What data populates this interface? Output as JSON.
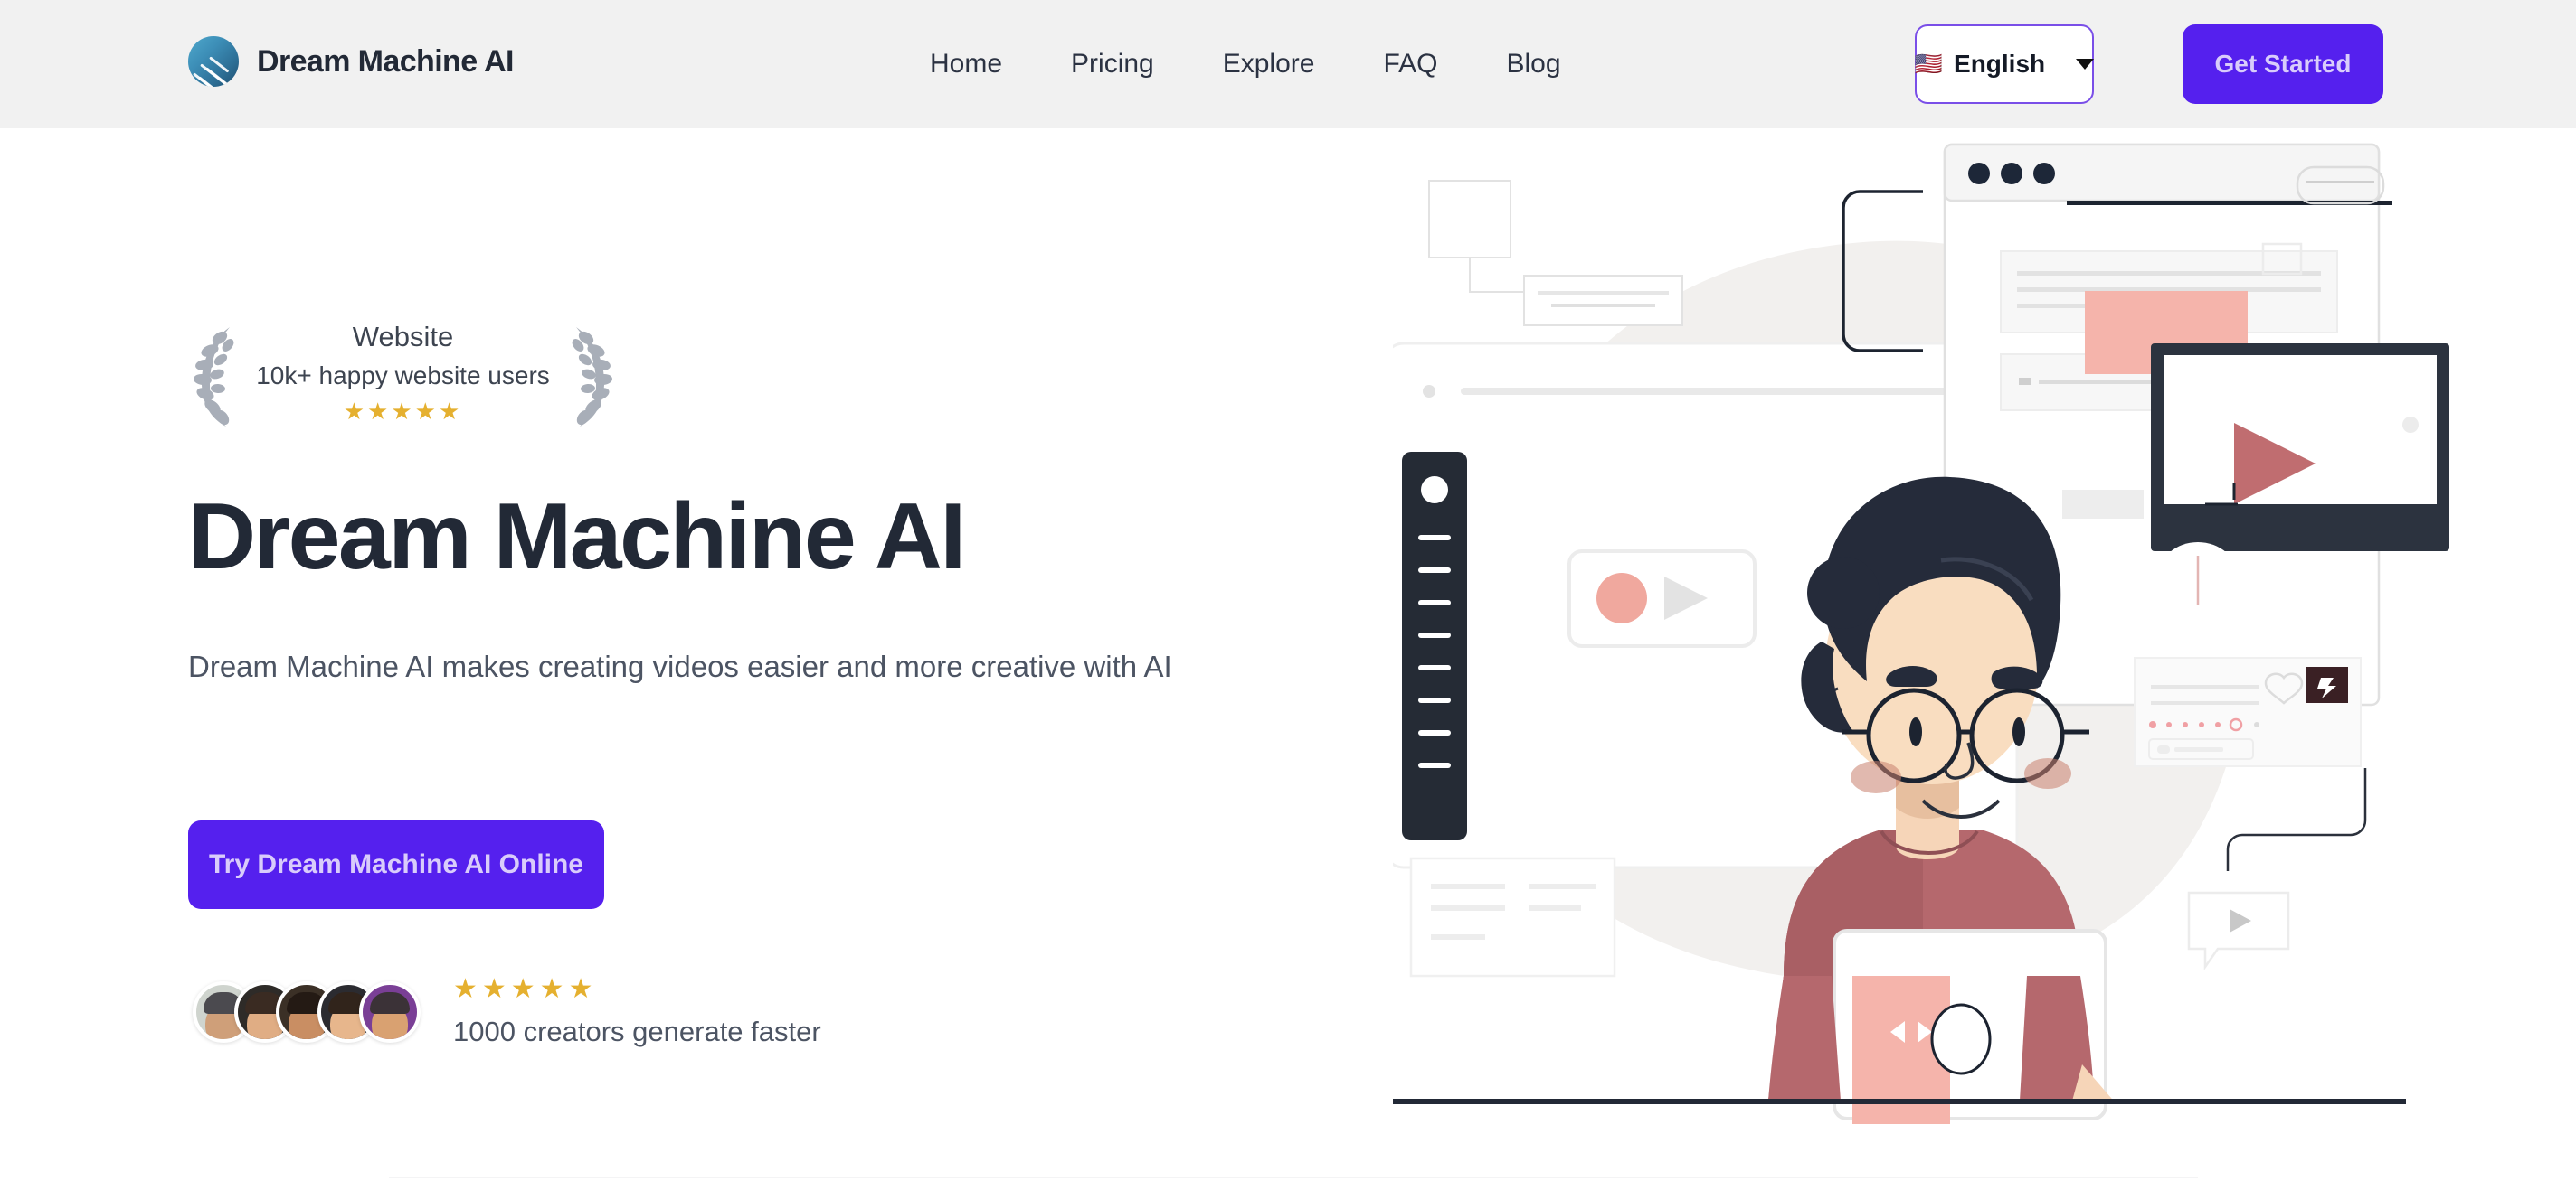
{
  "header": {
    "brand": {
      "name": "Dream Machine AI",
      "logo_icon": "dream-machine-logo-icon"
    },
    "nav": [
      {
        "label": "Home"
      },
      {
        "label": "Pricing"
      },
      {
        "label": "Explore"
      },
      {
        "label": "FAQ"
      },
      {
        "label": "Blog"
      }
    ],
    "language": {
      "flag": "🇺🇸",
      "label": "English",
      "chevron_icon": "chevron-down-icon"
    },
    "get_started_label": "Get Started",
    "background_color": "#f1f1f1"
  },
  "hero": {
    "badge": {
      "title": "Website",
      "subtitle": "10k+ happy website users",
      "stars": "★★★★★",
      "laurel_icon": "laurel-wreath-icon",
      "star_color": "#e5b02f",
      "laurel_color": "#a8aeb8"
    },
    "headline": "Dream Machine AI",
    "subheadline": "Dream Machine AI makes creating videos easier and more creative with AI",
    "cta_label": "Try Dream Machine AI Online",
    "social_proof": {
      "stars": "★★★★★",
      "text": "1000 creators generate faster",
      "avatar_count": 5
    },
    "illustration": {
      "name": "video-creator-illustration",
      "alt": "Person with glasses at laptop surrounded by video editing UI windows"
    }
  },
  "colors": {
    "accent_purple": "#5520ee",
    "accent_purple_text": "#d9ccfb",
    "heading_navy": "#222936",
    "body_gray": "#4c5463",
    "page_background": "#ffffff"
  }
}
